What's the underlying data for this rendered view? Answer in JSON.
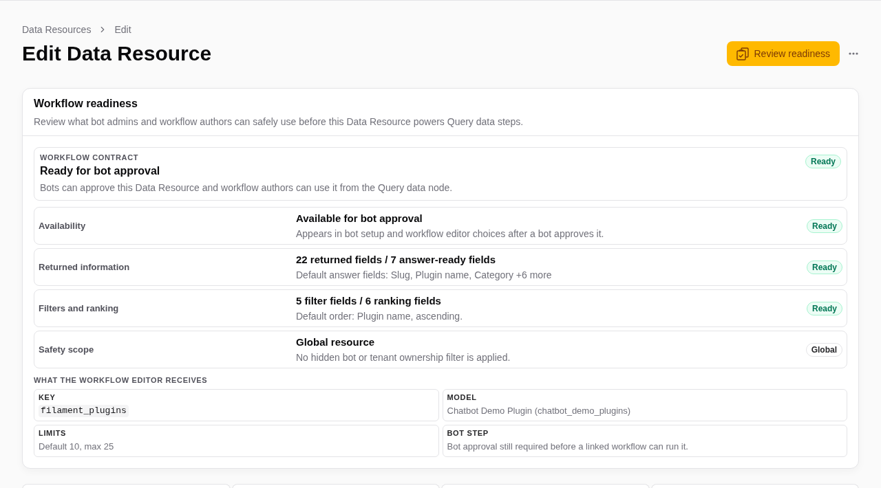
{
  "breadcrumbs": [
    {
      "label": "Data Resources"
    },
    {
      "label": "Edit"
    }
  ],
  "page": {
    "title": "Edit Data Resource"
  },
  "actions": {
    "primary": {
      "label": "Review readiness"
    }
  },
  "readiness_panel": {
    "title": "Workflow readiness",
    "description": "Review what bot admins and workflow authors can safely use before this Data Resource powers Query data steps.",
    "contract": {
      "eyebrow": "WORKFLOW CONTRACT",
      "title": "Ready for bot approval",
      "description": "Bots can approve this Data Resource and workflow authors can use it from the Query data node.",
      "badge": {
        "label": "Ready",
        "kind": "success"
      }
    },
    "checks": [
      {
        "label": "Availability",
        "title": "Available for bot approval",
        "description": "Appears in bot setup and workflow editor choices after a bot approves it.",
        "badge": {
          "label": "Ready",
          "kind": "success"
        }
      },
      {
        "label": "Returned information",
        "title": "22 returned fields / 7 answer-ready fields",
        "description": "Default answer fields: Slug, Plugin name, Category +6 more",
        "badge": {
          "label": "Ready",
          "kind": "success"
        }
      },
      {
        "label": "Filters and ranking",
        "title": "5 filter fields / 6 ranking fields",
        "description": "Default order: Plugin name, ascending.",
        "badge": {
          "label": "Ready",
          "kind": "success"
        }
      },
      {
        "label": "Safety scope",
        "title": "Global resource",
        "description": "No hidden bot or tenant ownership filter is applied.",
        "badge": {
          "label": "Global",
          "kind": "neutral"
        }
      }
    ],
    "receives": {
      "heading": "WHAT THE WORKFLOW EDITOR RECEIVES",
      "items": [
        {
          "label": "KEY",
          "value": "filament_plugins",
          "kind": "code"
        },
        {
          "label": "MODEL",
          "value": "Chatbot Demo Plugin (chatbot_demo_plugins)",
          "kind": "text"
        },
        {
          "label": "LIMITS",
          "value": "Default 10, max 25",
          "kind": "text"
        },
        {
          "label": "BOT STEP",
          "value": "Bot approval still required before a linked workflow can run it.",
          "kind": "text"
        }
      ]
    }
  }
}
